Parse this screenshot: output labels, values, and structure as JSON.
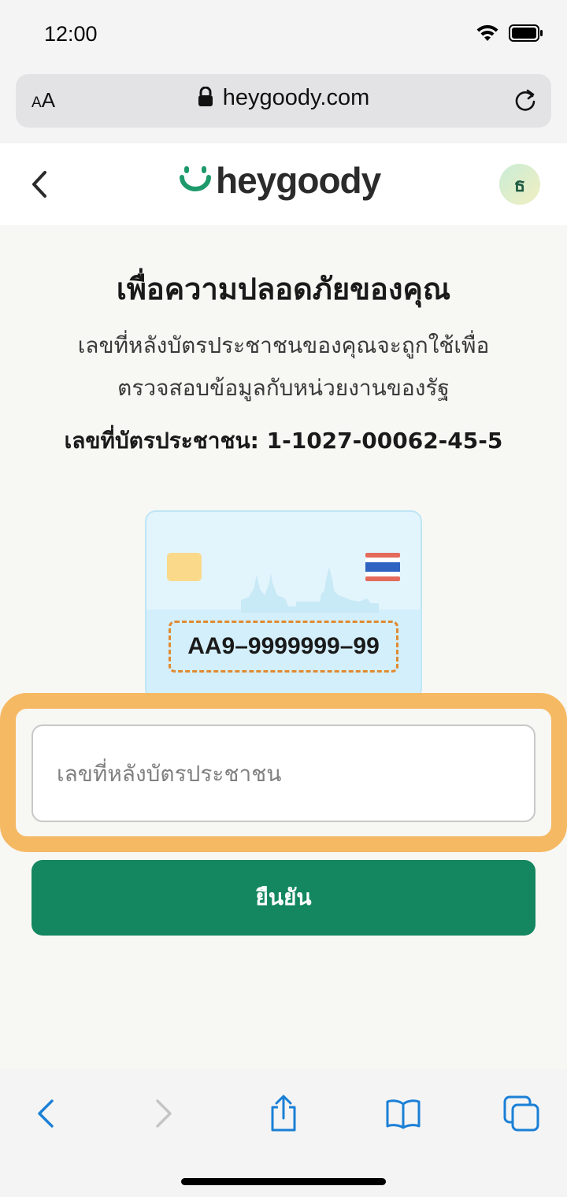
{
  "status_bar": {
    "time": "12:00"
  },
  "browser": {
    "aa_label_small": "A",
    "aa_label_large": "A",
    "url": "heygoody.com"
  },
  "header": {
    "logo_text": "heygoody",
    "avatar_initial": "ธ"
  },
  "main": {
    "title": "เพื่อความปลอดภัยของคุณ",
    "subtitle_line1": "เลขที่หลังบัตรประชาชนของคุณจะถูกใช้เพื่อ",
    "subtitle_line2": "ตรวจสอบข้อมูลกับหน่วยงานของรัฐ",
    "id_label": "เลขที่บัตรประชาชน: 1-1027-00062-45-5",
    "card_number_sample": "AA9–9999999–99",
    "input_placeholder": "เลขที่หลังบัตรประชาชน",
    "input_value": "",
    "confirm_label": "ยืนยัน"
  },
  "colors": {
    "brand_green": "#148760",
    "highlight_orange": "#f5b963",
    "link_blue": "#1a7fd6"
  },
  "toolbar": {
    "icons": [
      "back-icon",
      "forward-icon",
      "share-icon",
      "bookmarks-icon",
      "tabs-icon"
    ]
  }
}
